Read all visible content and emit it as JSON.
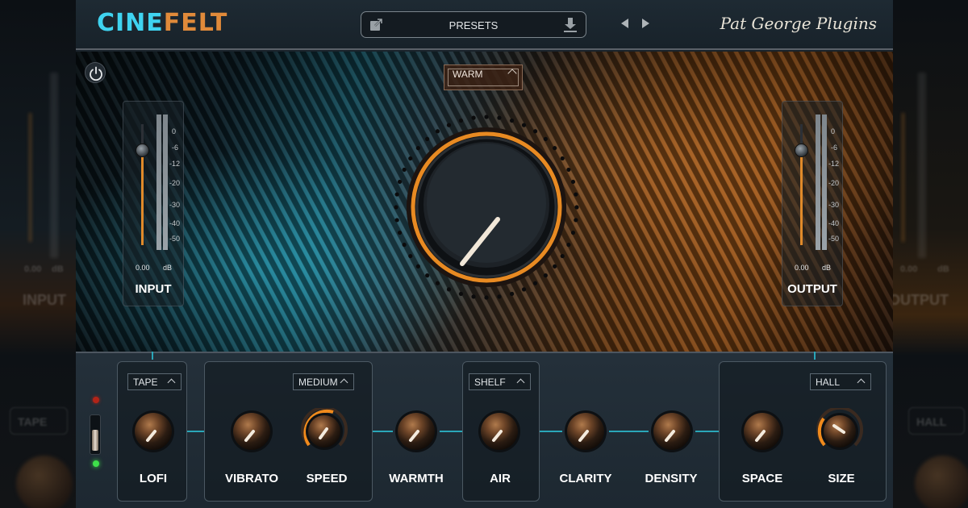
{
  "header": {
    "logo_part1": "CINE",
    "logo_part2": "FELT",
    "presets_label": "PRESETS",
    "brand": "Pat George Plugins"
  },
  "hero": {
    "mode_select": "WARM",
    "input_meter": {
      "name": "INPUT",
      "value": "0.00",
      "unit": "dB",
      "scale": [
        "0",
        "-6",
        "-12",
        "-20",
        "-30",
        "-40",
        "-50"
      ]
    },
    "output_meter": {
      "name": "OUTPUT",
      "value": "0.00",
      "unit": "dB",
      "scale": [
        "0",
        "-6",
        "-12",
        "-20",
        "-30",
        "-40",
        "-50"
      ]
    }
  },
  "controls": {
    "lofi_mode": "TAPE",
    "vibrato_mode": "MEDIUM",
    "air_mode": "SHELF",
    "space_mode": "HALL",
    "knobs": {
      "lofi": "LOFI",
      "vibrato": "VIBRATO",
      "speed": "SPEED",
      "warmth": "WARMTH",
      "air": "AIR",
      "clarity": "CLARITY",
      "density": "DENSITY",
      "space": "SPACE",
      "size": "SIZE"
    }
  },
  "background_ghosts": {
    "left_value": "0.00",
    "left_unit": "dB",
    "left_name": "INPUT",
    "left_mode": "TAPE",
    "right_value": "0.00",
    "right_unit": "dB",
    "right_name": "OUTPUT",
    "right_mode": "HALL"
  },
  "colors": {
    "accent_cyan": "#3fd3f0",
    "accent_orange": "#e08a3a",
    "connector": "#2aa6b8",
    "led_red": "#c0281e",
    "led_green": "#3ee04a"
  },
  "icons": {
    "export": "export-icon",
    "download": "download-icon",
    "prev": "chevron-left-icon",
    "next": "chevron-right-icon",
    "power": "power-icon"
  }
}
